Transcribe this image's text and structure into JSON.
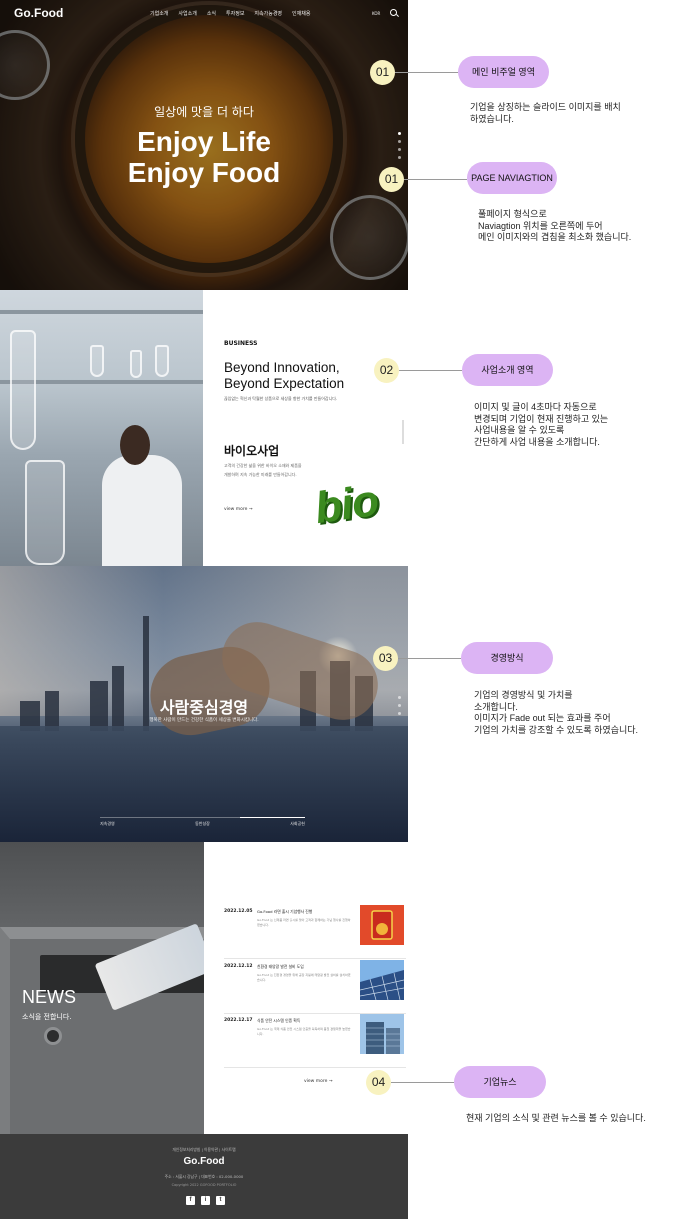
{
  "hero": {
    "logo": "Go.Food",
    "nav": [
      "기업소개",
      "사업소개",
      "소식",
      "투자정보",
      "지속가능경영",
      "인재채용"
    ],
    "lang": "KOR",
    "kicker": "일상에 맛을 더 하다",
    "headline1": "Enjoy Life",
    "headline2": "Enjoy Food"
  },
  "business": {
    "label": "BUSINESS",
    "title1": "Beyond Innovation,",
    "title2": "Beyond Expectation",
    "sub": "끊임없는 혁신과 탁월한 상품으로 세상을 향한 가치를 만들어갑니다.",
    "heading": "바이오사업",
    "para": "고객의 건강한 삶을 위한 바이오 소재와 제품을 개발하며 지속 가능한 미래를 만들어갑니다.",
    "more": "view more →",
    "bio_logo": "bio"
  },
  "management": {
    "title": "사람중심경영",
    "sub": "행복한 사람이 만드는 건강한 식품이 세상을 변화시킵니다.",
    "tabs": [
      "지속경영",
      "동반성장",
      "사회공헌"
    ]
  },
  "news": {
    "title": "NEWS",
    "subtitle": "소식을 전합니다.",
    "items": [
      {
        "date": "2022.12.05",
        "head": "Go.Food 라면 출시 기념행사 진행",
        "body": "Go.Food 는 신제품 라면 출시를 맞아 고객과 함께하는 기념 행사를 진행하였습니다."
      },
      {
        "date": "2022.12.12",
        "head": "친환경 태양광 발전 설비 도입",
        "body": "Go.Food 는 친환경 경영을 위해 공장 지붕에 태양광 발전 설비를 설치하였습니다."
      },
      {
        "date": "2022.12.17",
        "head": "식품 안전 시스템 인증 획득",
        "body": "Go.Food 는 국제 식품 안전 시스템 인증을 획득하며 품질 경쟁력을 높였습니다."
      }
    ],
    "more": "view more →"
  },
  "footer": {
    "links": "개인정보처리방침 | 이용약관 | 사이트맵",
    "logo": "Go.Food",
    "address": "주소 : 서울시 강남구 | 대표번호 : 02-000-0000",
    "copyright": "Copyright 2022 GOFOOD PORTFOLIO",
    "social": [
      "f",
      "i",
      "t"
    ]
  },
  "annotations": [
    {
      "num": "01",
      "pill": "메인 비주얼 영역",
      "text": [
        "기업을 상징하는 슬라이드 이미지를 배치",
        "하였습니다."
      ]
    },
    {
      "num": "01",
      "pill": "PAGE NAVIAGTION",
      "text": [
        "풀페이지 형식으로",
        "Naviagtion 위치를 오른쪽에 두어",
        "메인 이미지와의 겹침을 최소화 했습니다."
      ]
    },
    {
      "num": "02",
      "pill": "사업소개 영역",
      "text": [
        "이미지 및 글이 4초마다 자동으로",
        "변경되며 기업이 현재 진행하고 있는",
        "사업내용을 알 수 있도록",
        "간단하게 사업 내용을 소개합니다."
      ]
    },
    {
      "num": "03",
      "pill": "경영방식",
      "text": [
        "기업의 경영방식 및 가치를",
        "소개합니다.",
        "이미지가 Fade out 되는 효과를 주어",
        "기업의 가치를 강조할 수 있도록 하였습니다."
      ]
    },
    {
      "num": "04",
      "pill": "기업뉴스",
      "text": [
        "현재 기업의 소식 및 관련 뉴스를 볼 수 있습니다."
      ]
    }
  ]
}
